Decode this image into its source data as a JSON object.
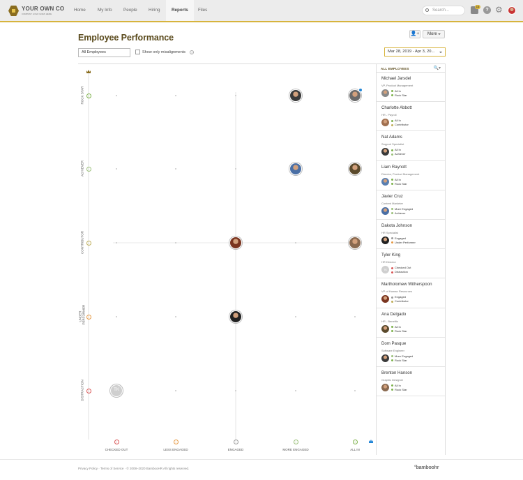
{
  "header": {
    "logo_name": "YOUR OWN CO",
    "logo_tag": "COMPANY LOGO GOES HERE",
    "nav": [
      "Home",
      "My Info",
      "People",
      "Hiring",
      "Reports",
      "Files"
    ],
    "active_nav": "Reports",
    "search_placeholder": "Search...",
    "inbox_count": "14",
    "help_glyph": "?",
    "gear_glyph": "⚙"
  },
  "page": {
    "title": "Employee Performance",
    "add_button_glyph": "👤+",
    "more_label": "More",
    "filter_value": "All Employees",
    "misalign_label": "Show only misalignments",
    "info_glyph": "?",
    "date_range": "Mar 28, 2019 - Apr 3, 20..."
  },
  "chart_data": {
    "type": "scatter",
    "y_categories": [
      "ROCK STAR",
      "ACHIEVER",
      "CONTRIBUTOR",
      "UNDER PERFORMER",
      "DISTRACTION"
    ],
    "x_categories": [
      "CHECKED OUT",
      "LESS ENGAGED",
      "ENGAGED",
      "MORE ENGAGED",
      "ALL IN"
    ],
    "points": [
      {
        "x": "MORE ENGAGED",
        "y": "ROCK STAR",
        "color": "#3a3a3a"
      },
      {
        "x": "ALL IN",
        "y": "ROCK STAR",
        "color": "#6a6a6a"
      },
      {
        "x": "MORE ENGAGED",
        "y": "ACHIEVER",
        "color": "#4a6fa5"
      },
      {
        "x": "ALL IN",
        "y": "ACHIEVER",
        "color": "#5b4a2c"
      },
      {
        "x": "ENGAGED",
        "y": "CONTRIBUTOR",
        "color": "#7a3520"
      },
      {
        "x": "ALL IN",
        "y": "CONTRIBUTOR",
        "color": "#8a6a50"
      },
      {
        "x": "ENGAGED",
        "y": "UNDER PERFORMER",
        "color": "#222222"
      },
      {
        "x": "CHECKED OUT",
        "y": "DISTRACTION",
        "color": "#cfcfcf",
        "initials": "TK"
      }
    ],
    "grid": true
  },
  "panel": {
    "header": "ALL EMPLOYEES",
    "search_glyph": "🔍▾",
    "employees": [
      {
        "name": "Michael Jarsdel",
        "title": "VP, Product Management",
        "status1": "All In",
        "status2": "Rock Star",
        "avatar": "#888"
      },
      {
        "name": "Charlotte Abbott",
        "title": "HR - Payroll",
        "status1": "All In",
        "status2": "Contributor",
        "avatar": "#a07050"
      },
      {
        "name": "Nat Adams",
        "title": "Support Specialist",
        "status1": "All In",
        "status2": "Achiever",
        "avatar": "#3b3b3b"
      },
      {
        "name": "Liam Raynott",
        "title": "Director, Product Management",
        "status1": "All In",
        "status2": "Rock Star",
        "avatar": "#5a7fb0"
      },
      {
        "name": "Javier Cruz",
        "title": "Content Marketer",
        "status1": "More Engaged",
        "status2": "Achiever",
        "avatar": "#4a6fa5"
      },
      {
        "name": "Dakota Johnson",
        "title": "HR Specialist",
        "status1": "Engaged",
        "status2": "Under Performer",
        "avatar": "#222"
      },
      {
        "name": "Tyler King",
        "title": "HR Director",
        "status1": "Checked Out",
        "status2": "Distraction",
        "avatar": "#cfcfcf",
        "initials": "TK"
      },
      {
        "name": "Martholomew Witherspoon",
        "title": "VP of Human Resources",
        "status1": "Engaged",
        "status2": "Contributor",
        "avatar": "#7a3520"
      },
      {
        "name": "Ana Delgado",
        "title": "HR - Benefits",
        "status1": "All In",
        "status2": "Rock Star",
        "avatar": "#5b4a2c"
      },
      {
        "name": "Dom Pasque",
        "title": "Software Engineer",
        "status1": "More Engaged",
        "status2": "Rock Star",
        "avatar": "#3a3a3a"
      },
      {
        "name": "Brenton Hanson",
        "title": "Graphic Designer",
        "status1": "All In",
        "status2": "Rock Star",
        "avatar": "#8a6a50"
      }
    ]
  },
  "footer": {
    "text": "Privacy Policy  ·  Terms of Service  ·  © 2008–2020 BambooHR All rights reserved.",
    "brand": "°bamboohr"
  },
  "colors": {
    "accent": "#d7b43d",
    "title": "#5a4a1c",
    "green": "#7fb24d",
    "red": "#d95757"
  }
}
